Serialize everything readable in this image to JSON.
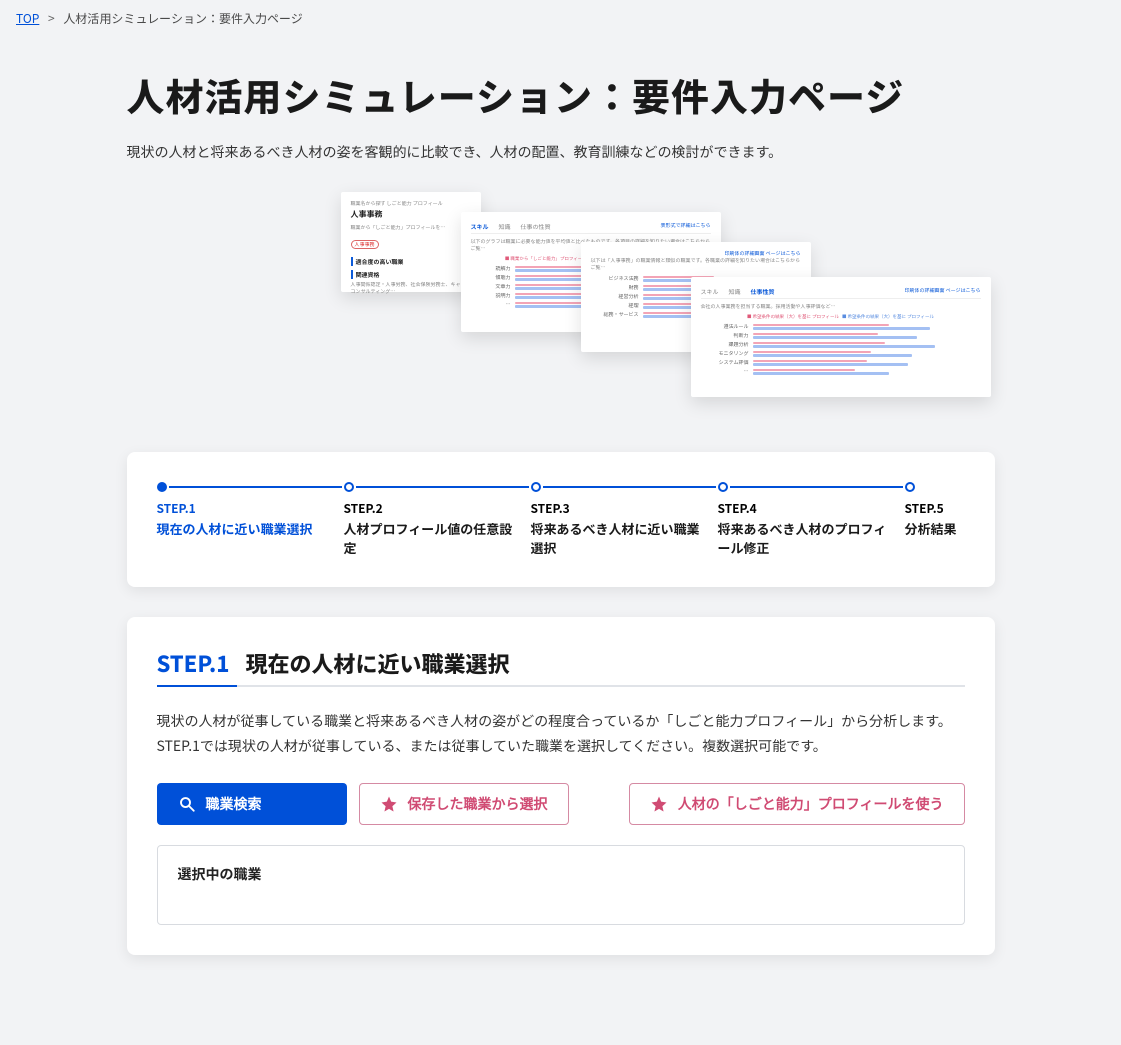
{
  "breadcrumb": {
    "top_label": "TOP",
    "current": "人材活用シミュレーション：要件入力ページ"
  },
  "page": {
    "title": "人材活用シミュレーション：要件入力ページ",
    "subtitle": "現状の人材と将来あるべき人材の姿を客観的に比較でき、人材の配置、教育訓練などの検討ができます。"
  },
  "hero": {
    "card1": {
      "tiny": "職業名から探す しごと能力 プロフィール",
      "title": "人事事務",
      "sub": "職業から「しごと能力」プロフィールを…",
      "badge": "人事事務",
      "section1": "適合度の高い職業",
      "section2": "関連資格",
      "footer": "人事関係認定・人事労務、社会保険労務士、キャリアコンサルティング…"
    },
    "card2": {
      "tabs": {
        "t1": "スキル",
        "t2": "知識",
        "t3": "仕事の性質"
      },
      "link": "表形式で詳細はこちら",
      "desc": "以下のグラフは職業に必要な能力値を平均値と比べたものです。各項目の詳細を知りたい場合はこちらからご覧…",
      "legend_red": "■ 職業から「しごと能力」プロフィール",
      "legend_blue": "■ 印刷体から「しごと能力」プロフィール",
      "rows": [
        "読解力",
        "傾聴力",
        "文章力",
        "説明力",
        "…"
      ]
    },
    "card3": {
      "link": "印刷体の詳細画面 ページはこちら",
      "desc": "以下は「人事事務」の職業情報と類似の職業です。各職業の詳細を知りたい場合はこちらからご覧…",
      "rows": [
        "ビジネス法務",
        "財務",
        "経営分析",
        "経理",
        "総務・サービス"
      ]
    },
    "card4": {
      "tabs": {
        "t1": "スキル",
        "t2": "知識",
        "t3": "仕事性質"
      },
      "link": "印刷体の詳細画面 ページはこちら",
      "desc": "会社の人事業務を担当する職業。採用活動や人事評価など…",
      "legend_red": "■ 希望条件の結果（大）を基に プロフィール",
      "legend_blue": "■ 希望条件の結果（大）を基に プロフィール",
      "rows": [
        "遵法ルール",
        "判断力",
        "課題分析",
        "モニタリング",
        "システム評価",
        "…"
      ]
    }
  },
  "steps": [
    {
      "label": "STEP.1",
      "caption": "現在の人材に近い職業選択",
      "active": true
    },
    {
      "label": "STEP.2",
      "caption": "人材プロフィール値の任意設定",
      "active": false
    },
    {
      "label": "STEP.3",
      "caption": "将来あるべき人材に近い職業選択",
      "active": false
    },
    {
      "label": "STEP.4",
      "caption": "将来あるべき人材のプロフィール修正",
      "active": false
    },
    {
      "label": "STEP.5",
      "caption": "分析結果",
      "active": false
    }
  ],
  "section1": {
    "step_label": "STEP.1",
    "title": "現在の人材に近い職業選択",
    "description": "現状の人材が従事している職業と将来あるべき人材の姿がどの程度合っているか「しごと能力プロフィール」から分析します。STEP.1では現状の人材が従事している、または従事していた職業を選択してください。複数選択可能です。",
    "btn_search": "職業検索",
    "btn_saved": "保存した職業から選択",
    "btn_profile": "人材の「しごと能力」プロフィールを使う",
    "selected_title": "選択中の職業"
  }
}
